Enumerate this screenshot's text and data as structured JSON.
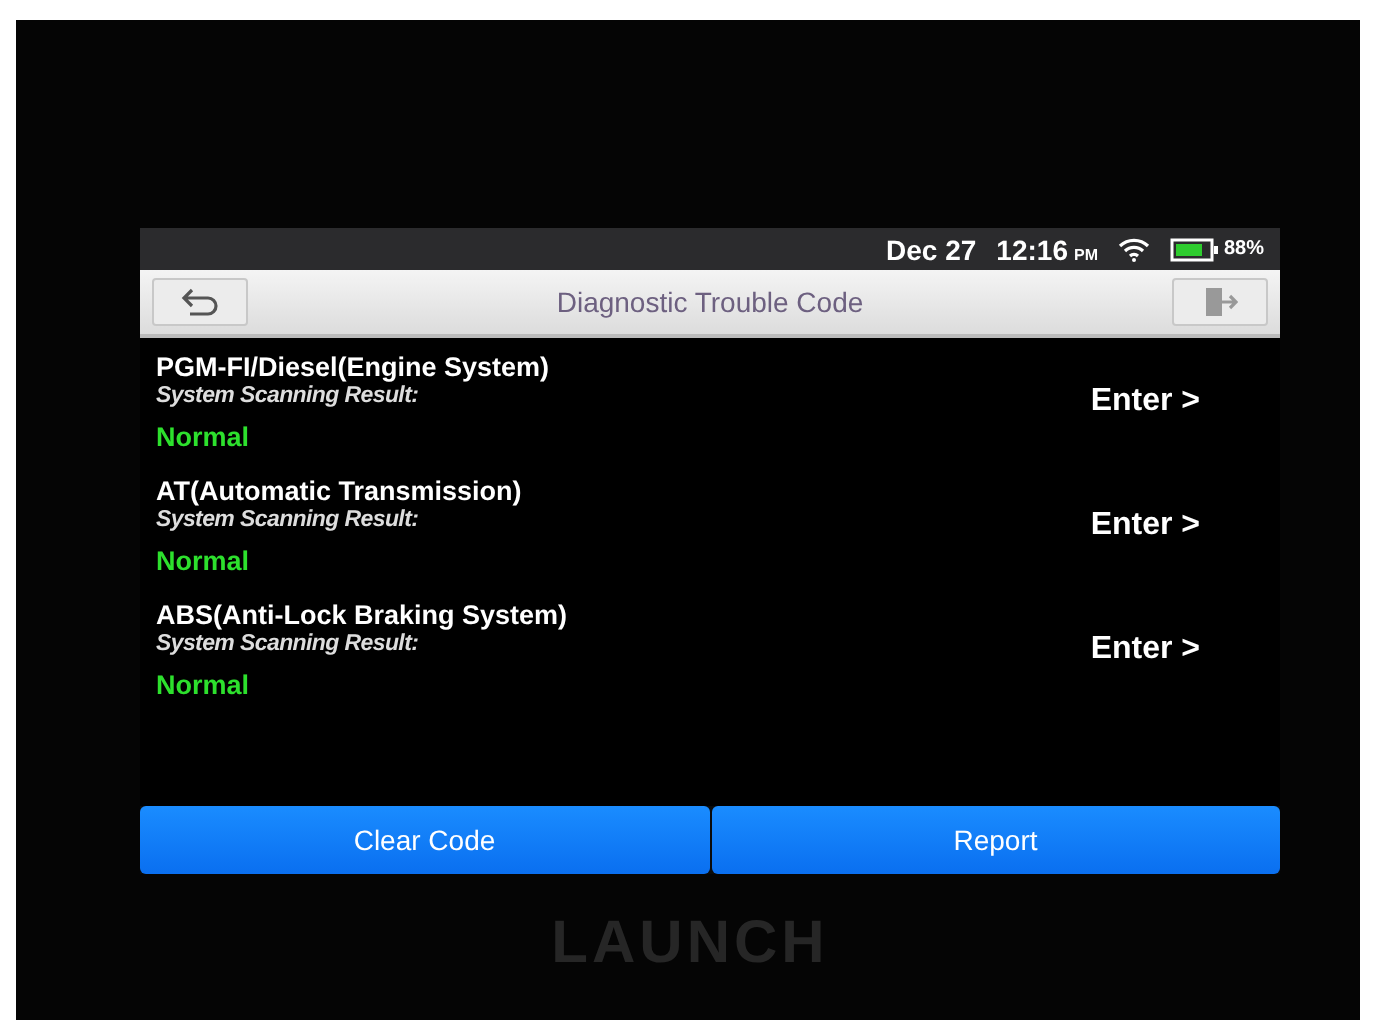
{
  "status_bar": {
    "date": "Dec 27",
    "time": "12:16",
    "meridiem": "PM",
    "battery": "88%"
  },
  "title_bar": {
    "title": "Diagnostic Trouble Code"
  },
  "systems": [
    {
      "name": "PGM-FI/Diesel(Engine System)",
      "result_label": "System Scanning Result:",
      "result": "Normal",
      "action": "Enter >"
    },
    {
      "name": "AT(Automatic Transmission)",
      "result_label": "System Scanning Result:",
      "result": "Normal",
      "action": "Enter >"
    },
    {
      "name": "ABS(Anti-Lock Braking System)",
      "result_label": "System Scanning Result:",
      "result": "Normal",
      "action": "Enter >"
    }
  ],
  "buttons": [
    "Clear Code",
    "Report"
  ],
  "device": {
    "brand": "LAUNCH"
  }
}
